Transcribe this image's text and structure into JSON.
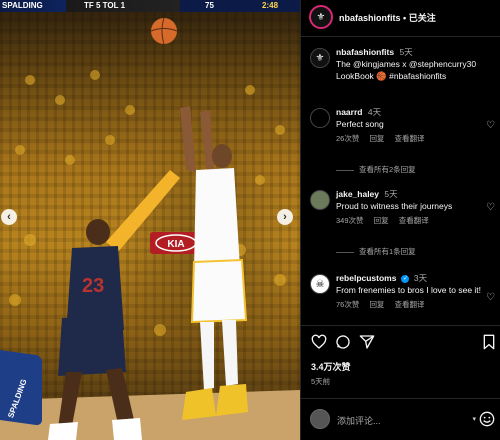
{
  "scoreboard": {
    "left": "SPALDING",
    "mid": "TF 5   TOL 1",
    "right": "75",
    "time": "2:48"
  },
  "media": {
    "court_sign": "KIA",
    "floor_ad": "SPALDING",
    "jersey_number": "23"
  },
  "post": {
    "username": "nbafashionfits",
    "follow": "已关注",
    "caption_time": "5天",
    "caption": "The @kingjames x @stephencurry30 LookBook 🏀 #nbafashionfits",
    "likes": "3.4万次赞",
    "posted": "5天前"
  },
  "comments": [
    {
      "user": "naarrd",
      "time": "4天",
      "text": "Perfect song",
      "likes": "26次赞",
      "reply": "回复",
      "translate": "查看翻译",
      "more": "查看所有2条回复"
    },
    {
      "user": "jake_haley",
      "time": "5天",
      "text": "Proud to witness their journeys",
      "likes": "349次赞",
      "reply": "回复",
      "translate": "查看翻译",
      "more": "查看所有1条回复"
    },
    {
      "user": "rebelpcustoms",
      "time": "3天",
      "text": "From frenemies to bros I love to see it!",
      "likes": "76次赞",
      "reply": "回复",
      "translate": "查看翻译"
    }
  ],
  "composer": {
    "placeholder": "添加评论..."
  },
  "colors": {
    "background": "#000000",
    "text": "#f5f5f5",
    "muted": "#a8a8a8",
    "verified": "#0095f6",
    "story_ring": "#d62976"
  }
}
